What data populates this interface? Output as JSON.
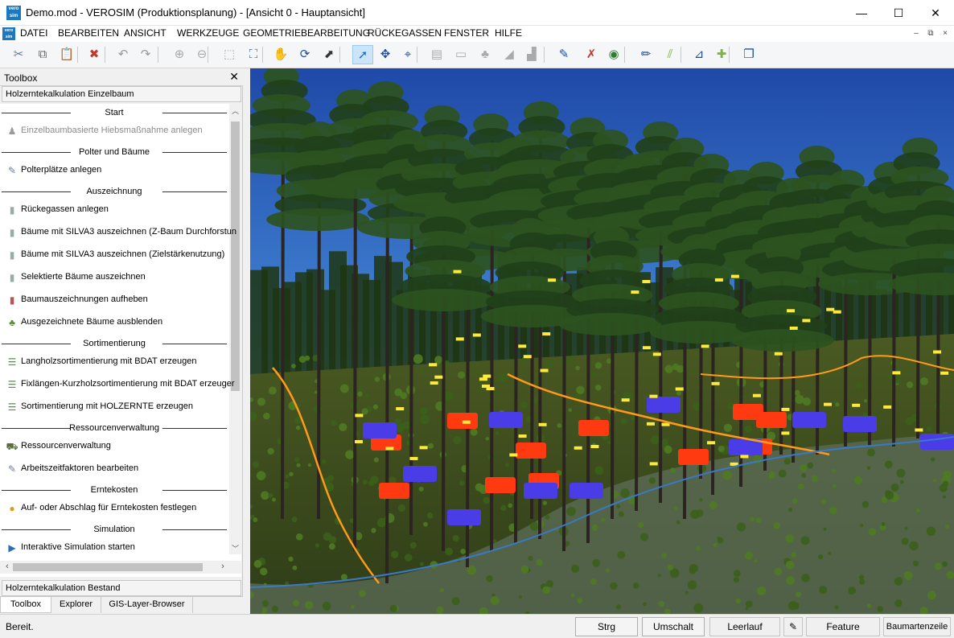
{
  "window": {
    "title": "Demo.mod - VEROSIM (Produktionsplanung) - [Ansicht 0 - Hauptansicht]",
    "logo_text": "vero sim",
    "minimize": "—",
    "maximize": "☐",
    "close": "✕"
  },
  "menu": {
    "items": [
      "DATEI",
      "BEARBEITEN",
      "ANSICHT",
      "WERKZEUGE",
      "GEOMETRIEBEARBEITUNG",
      "RÜCKEGASSEN",
      "FENSTER",
      "HILFE"
    ],
    "mdi_minimize": "–",
    "mdi_restore": "⧉",
    "mdi_close": "×"
  },
  "toolbar": {
    "buttons": [
      {
        "name": "cut-icon",
        "glyph": "✂",
        "color": "#4a7fb5"
      },
      {
        "name": "copy-icon",
        "glyph": "⧉",
        "color": "#666"
      },
      {
        "name": "paste-icon",
        "glyph": "📋",
        "color": "#999"
      },
      {
        "name": "delete-icon",
        "glyph": "✖",
        "color": "#c0392b"
      },
      {
        "name": "undo-icon",
        "glyph": "↶",
        "color": "#999"
      },
      {
        "name": "redo-icon",
        "glyph": "↷",
        "color": "#999"
      },
      {
        "name": "zoom-in-icon",
        "glyph": "⊕",
        "color": "#aaa"
      },
      {
        "name": "zoom-out-icon",
        "glyph": "⊖",
        "color": "#aaa"
      },
      {
        "name": "zoom-box-icon",
        "glyph": "⬚",
        "color": "#aaa"
      },
      {
        "name": "zoom-fit-icon",
        "glyph": "⛶",
        "color": "#3b6fb6"
      },
      {
        "name": "pan-hand-icon",
        "glyph": "✋",
        "color": "#333"
      },
      {
        "name": "rotate-icon",
        "glyph": "⟳",
        "color": "#1f4f9a"
      },
      {
        "name": "north-icon",
        "glyph": "⬈",
        "color": "#333"
      },
      {
        "name": "select-icon",
        "glyph": "➚",
        "color": "#1f6fc0"
      },
      {
        "name": "move-point-icon",
        "glyph": "✥",
        "color": "#1f4f9a"
      },
      {
        "name": "axes-icon",
        "glyph": "⌖",
        "color": "#1f4f9a"
      },
      {
        "name": "grid-1-icon",
        "glyph": "▤",
        "color": "#aaa"
      },
      {
        "name": "grid-2-icon",
        "glyph": "▭",
        "color": "#aaa"
      },
      {
        "name": "tree-tool-icon",
        "glyph": "♣",
        "color": "#aaa"
      },
      {
        "name": "slope-icon",
        "glyph": "◢",
        "color": "#aaa"
      },
      {
        "name": "terrain-icon",
        "glyph": "▟",
        "color": "#aaa"
      },
      {
        "name": "edit-path-icon",
        "glyph": "✎",
        "color": "#1f4f9a"
      },
      {
        "name": "remove-mark-icon",
        "glyph": "✗",
        "color": "#c0392b"
      },
      {
        "name": "globe-icon",
        "glyph": "◉",
        "color": "#2e7d32"
      },
      {
        "name": "pen-icon",
        "glyph": "✏",
        "color": "#1f4f9a"
      },
      {
        "name": "lines-icon",
        "glyph": "⫽",
        "color": "#7cb342"
      },
      {
        "name": "measure-icon",
        "glyph": "⊿",
        "color": "#1f4f9a"
      },
      {
        "name": "add-shape-icon",
        "glyph": "✚",
        "color": "#7cb342"
      },
      {
        "name": "layers-icon",
        "glyph": "❐",
        "color": "#1f4f9a"
      }
    ]
  },
  "toolbox": {
    "title": "Toolbox",
    "close": "✕",
    "group_top": "Holzerntekalkulation Einzelbaum",
    "group_bottom": "Holzerntekalkulation Bestand",
    "sections": [
      {
        "label": "Start",
        "items": [
          {
            "label": "Einzelbaumbasierte Hiebsmaßnahme anlegen",
            "icon": "person-tree-icon",
            "glyph": "♟",
            "color": "#999",
            "disabled": true
          }
        ]
      },
      {
        "label": "Polter und Bäume",
        "items": [
          {
            "label": "Polterplätze anlegen",
            "icon": "log-pile-icon",
            "glyph": "✎",
            "color": "#6a7c9a",
            "disabled": false
          }
        ]
      },
      {
        "label": "Auszeichnung",
        "items": [
          {
            "label": "Rückegassen anlegen",
            "icon": "marker-spray-icon",
            "glyph": "▮",
            "color": "#9aa",
            "disabled": false
          },
          {
            "label": "Bäume mit SILVA3 auszeichnen (Z-Baum Durchforstun",
            "icon": "marker-spray-icon",
            "glyph": "▮",
            "color": "#9aa",
            "disabled": false
          },
          {
            "label": "Bäume mit SILVA3 auszeichnen (Zielstärkenutzung)",
            "icon": "marker-spray-icon",
            "glyph": "▮",
            "color": "#9aa",
            "disabled": false
          },
          {
            "label": "Selektierte Bäume auszeichnen",
            "icon": "marker-spray-icon",
            "glyph": "▮",
            "color": "#9aa",
            "disabled": false
          },
          {
            "label": "Baumauszeichnungen aufheben",
            "icon": "unmark-icon",
            "glyph": "▮",
            "color": "#b55",
            "disabled": false
          },
          {
            "label": "Ausgezeichnete Bäume ausblenden",
            "icon": "hide-trees-icon",
            "glyph": "♣",
            "color": "#5a8a3a",
            "disabled": false
          }
        ]
      },
      {
        "label": "Sortimentierung",
        "items": [
          {
            "label": "Langholzsortimentierung mit BDAT erzeugen",
            "icon": "sort-list-icon",
            "glyph": "☰",
            "color": "#4a9a3a",
            "disabled": false
          },
          {
            "label": "Fixlängen-Kurzholzsortimentierung mit BDAT erzeuger",
            "icon": "sort-list-icon",
            "glyph": "☰",
            "color": "#4a9a3a",
            "disabled": false
          },
          {
            "label": "Sortimentierung mit HOLZERNTE erzeugen",
            "icon": "sort-list-icon",
            "glyph": "☰",
            "color": "#4a9a3a",
            "disabled": false
          }
        ]
      },
      {
        "label": "Ressourcenverwaltung",
        "items": [
          {
            "label": "Ressourcenverwaltung",
            "icon": "machine-icon",
            "glyph": "⛟",
            "color": "#5a6e3a",
            "disabled": false
          },
          {
            "label": "Arbeitszeitfaktoren bearbeiten",
            "icon": "edit-table-icon",
            "glyph": "✎",
            "color": "#6a7c9a",
            "disabled": false
          }
        ]
      },
      {
        "label": "Erntekosten",
        "items": [
          {
            "label": "Auf- oder Abschlag für Erntekosten festlegen",
            "icon": "coins-icon",
            "glyph": "●",
            "color": "#d4a020",
            "disabled": false
          }
        ]
      },
      {
        "label": "Simulation",
        "items": [
          {
            "label": "Interaktive Simulation starten",
            "icon": "play-icon",
            "glyph": "▶",
            "color": "#2f6fb5",
            "disabled": false
          }
        ]
      }
    ],
    "tabs": [
      "Toolbox",
      "Explorer",
      "GIS-Layer-Browser"
    ],
    "active_tab": "Toolbox"
  },
  "statusbar": {
    "text": "Bereit.",
    "buttons": [
      "Strg",
      "Umschalt",
      "Leerlauf",
      "Feature",
      "Baumartenzeile"
    ]
  },
  "colors": {
    "accent": "#1c79c0",
    "marker_red": "#ff3a10",
    "marker_blue": "#4a3ce6",
    "path_orange": "#ff9a1a",
    "path_blue": "#3a78c8"
  }
}
